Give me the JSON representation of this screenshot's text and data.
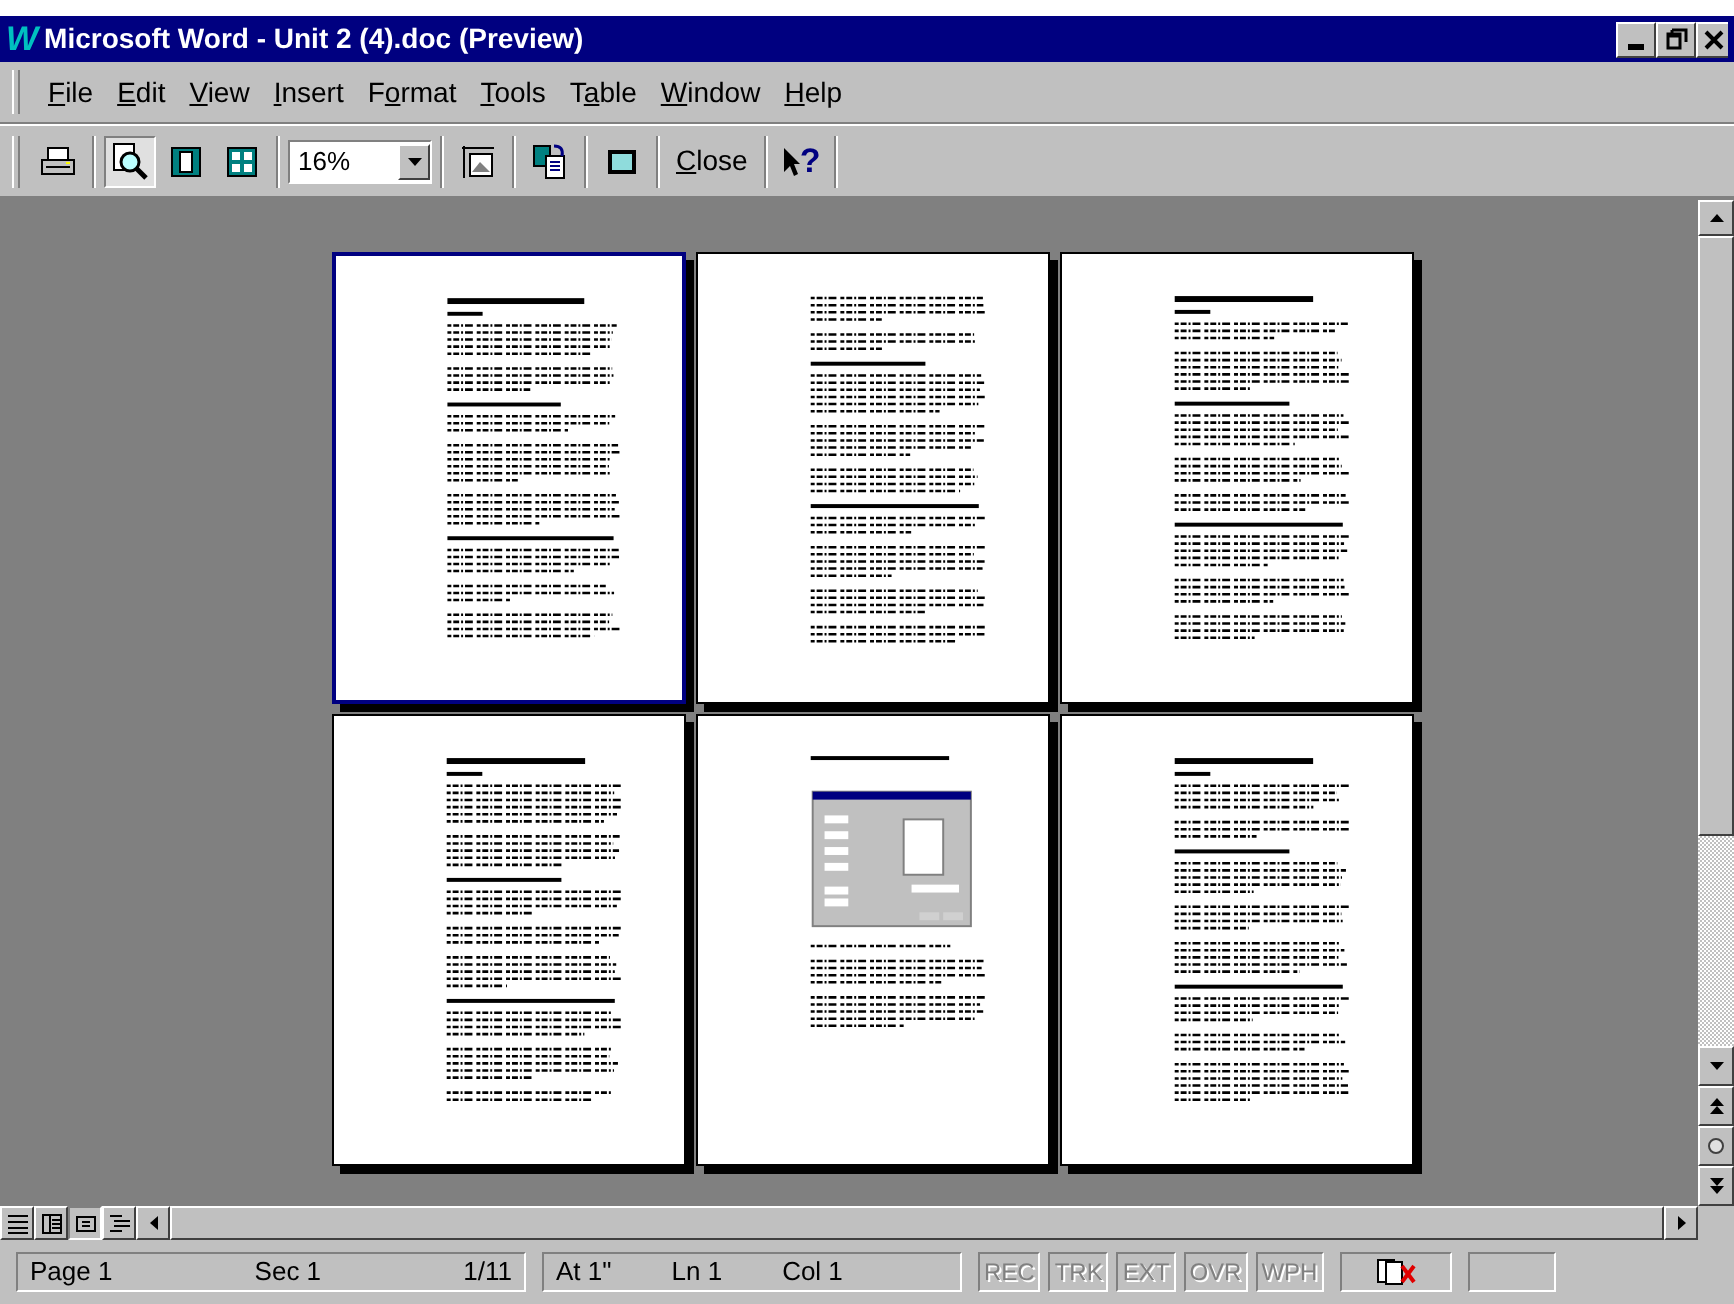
{
  "window": {
    "app_icon": "W",
    "title": "Microsoft Word - Unit 2 (4).doc (Preview)"
  },
  "menu": [
    {
      "key": "F",
      "after": "ile"
    },
    {
      "key": "E",
      "after": "dit"
    },
    {
      "key": "V",
      "after": "iew"
    },
    {
      "key": "I",
      "after": "nsert"
    },
    {
      "before": "F",
      "key": "o",
      "after": "rmat"
    },
    {
      "key": "T",
      "after": "ools"
    },
    {
      "before": "T",
      "key": "a",
      "after": "ble"
    },
    {
      "key": "W",
      "after": "indow"
    },
    {
      "key": "H",
      "after": "elp"
    }
  ],
  "toolbar": {
    "magnifier_pressed": true,
    "zoom": "16%",
    "close": {
      "key": "C",
      "after": "lose"
    },
    "help": "?"
  },
  "pages": [
    {
      "kind": "text",
      "selected": true
    },
    {
      "kind": "text",
      "selected": false
    },
    {
      "kind": "text",
      "selected": false
    },
    {
      "kind": "text",
      "selected": false
    },
    {
      "kind": "figure",
      "selected": false
    },
    {
      "kind": "text",
      "selected": false
    }
  ],
  "status_bar": {
    "fields": [
      [
        "Page 1",
        "Sec 1",
        "1/11"
      ],
      [
        "At 1\"",
        "Ln 1",
        "Col 1"
      ]
    ],
    "modes": [
      {
        "label": "REC",
        "disabled": true
      },
      {
        "label": "TRK",
        "disabled": true
      },
      {
        "label": "EXT",
        "disabled": true
      },
      {
        "label": "OVR",
        "disabled": true
      },
      {
        "label": "WPH",
        "disabled": true
      }
    ]
  }
}
